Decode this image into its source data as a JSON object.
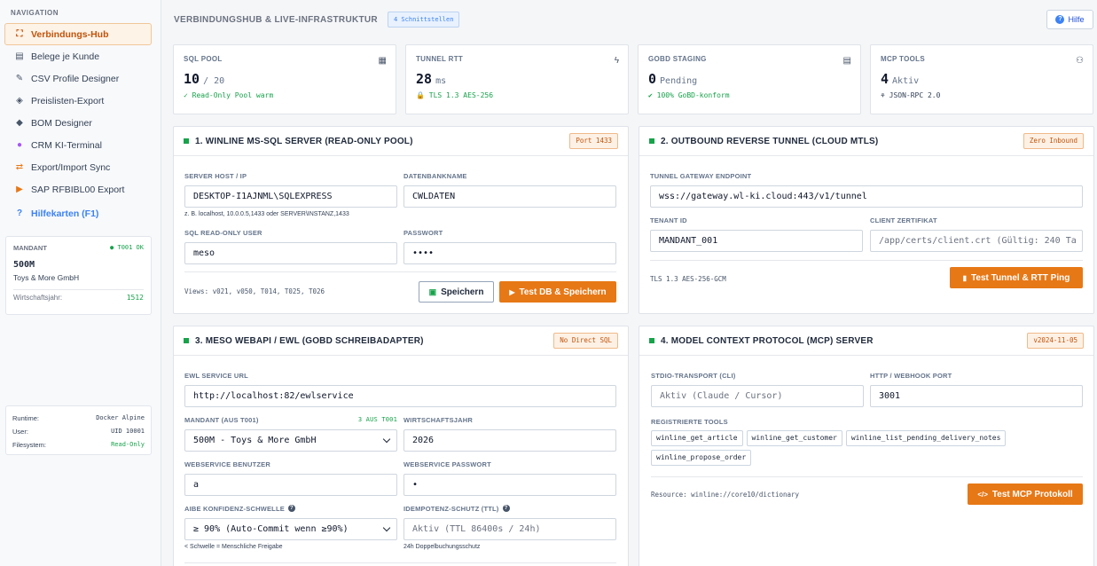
{
  "nav": {
    "heading": "NAVIGATION",
    "items": [
      {
        "label": "Verbindungs-Hub",
        "icon": "network-icon",
        "glyph": "⛶"
      },
      {
        "label": "Belege je Kunde",
        "icon": "document-icon",
        "glyph": "▤"
      },
      {
        "label": "CSV Profile Designer",
        "icon": "wand-icon",
        "glyph": "✎"
      },
      {
        "label": "Preislisten-Export",
        "icon": "tags-icon",
        "glyph": "◈"
      },
      {
        "label": "BOM Designer",
        "icon": "cubes-icon",
        "glyph": "◆"
      },
      {
        "label": "CRM KI-Terminal",
        "icon": "brain-icon",
        "glyph": "●"
      },
      {
        "label": "Export/Import Sync",
        "icon": "exchange-icon",
        "glyph": "⇄"
      },
      {
        "label": "SAP RFBIBL00 Export",
        "icon": "file-export-icon",
        "glyph": "▶"
      }
    ],
    "help": {
      "label": "Hilfekarten (F1)",
      "glyph": "?"
    }
  },
  "mandant": {
    "heading": "MANDANT",
    "status": "T001 OK",
    "code": "500M",
    "name": "Toys & More GmbH",
    "year_label": "Wirtschaftsjahr:",
    "year": "1512"
  },
  "runtime": [
    {
      "k": "Runtime:",
      "v": "Docker Alpine"
    },
    {
      "k": "User:",
      "v": "UID 10001"
    },
    {
      "k": "Filesystem:",
      "v": "Read-Only"
    }
  ],
  "header": {
    "title": "VERBINDUNGSHUB & LIVE-INFRASTRUKTUR",
    "badge": "4 Schnittstellen",
    "help": "Hilfe"
  },
  "stats": [
    {
      "label": "SQL POOL",
      "icon": "database-icon",
      "glyph": "▦",
      "value": "10",
      "unit": "/ 20",
      "sub": "✓ Read-Only Pool warm"
    },
    {
      "label": "TUNNEL RTT",
      "icon": "bolt-icon",
      "glyph": "ϟ",
      "value": "28",
      "unit": "ms",
      "sub": "🔒 TLS 1.3 AES-256"
    },
    {
      "label": "GOBD STAGING",
      "icon": "file-icon",
      "glyph": "▤",
      "value": "0",
      "unit": "Pending",
      "sub": "✔ 100% GoBD-konform"
    },
    {
      "label": "MCP TOOLS",
      "icon": "robot-icon",
      "glyph": "⚇",
      "value": "4",
      "unit": "Aktiv",
      "sub": "⚘ JSON-RPC 2.0"
    }
  ],
  "sql": {
    "title": "1. WINLINE MS-SQL SERVER (READ-ONLY POOL)",
    "tag": "Port 1433",
    "host_label": "SERVER HOST / IP",
    "host": "DESKTOP-I1AJNML\\SQLEXPRESS",
    "host_hint": "z. B. localhost, 10.0.0.5,1433 oder SERVER\\INSTANZ,1433",
    "db_label": "DATENBANKNAME",
    "db": "CWLDATEN",
    "user_label": "SQL READ-ONLY USER",
    "user": "meso",
    "pw_label": "PASSWORT",
    "pw": "••••",
    "views": "Views: v021, v050, T014, T025, T026",
    "save": "Speichern",
    "test": "Test DB & Speichern"
  },
  "tunnel": {
    "title": "2. OUTBOUND REVERSE TUNNEL (CLOUD MTLS)",
    "tag": "Zero Inbound",
    "ep_label": "TUNNEL GATEWAY ENDPOINT",
    "ep": "wss://gateway.wl-ki.cloud:443/v1/tunnel",
    "tid_label": "TENANT ID",
    "tid": "MANDANT_001",
    "cert_label": "CLIENT ZERTIFIKAT",
    "cert": "/app/certs/client.crt (Gültig: 240 Ta",
    "foot": "TLS 1.3 AES-256-GCM",
    "btn": "Test Tunnel & RTT Ping"
  },
  "ewl": {
    "title": "3. MESO WEBAPI / EWL (GOBD SCHREIBADAPTER)",
    "tag": "No Direct SQL",
    "url_label": "EWL SERVICE URL",
    "url": "http://localhost:82/ewlservice",
    "mandant_label": "MANDANT (AUS T001)",
    "mandant_note": "3 AUS T001",
    "mandant": "500M - Toys & More GmbH",
    "wj_label": "WIRTSCHAFTSJAHR",
    "wj": "2026",
    "user_label": "WEBSERVICE BENUTZER",
    "user": "a",
    "pw_label": "WEBSERVICE PASSWORT",
    "pw": "•",
    "conf_label": "AIBE KONFIDENZ-SCHWELLE",
    "conf": "≥ 90% (Auto-Commit wenn ≥90%)",
    "conf_hint": "< Schwelle = Menschliche Freigabe",
    "idem_label": "IDEMPOTENZ-SCHUTZ (TTL)",
    "idem": "Aktiv (TTL 86400s / 24h)",
    "idem_hint": "24h Doppelbuchungsschutz"
  },
  "mcp": {
    "title": "4. MODEL CONTEXT PROTOCOL (MCP) SERVER",
    "tag": "v2024-11-05",
    "stdio_label": "STDIO-TRANSPORT (CLI)",
    "stdio": "Aktiv (Claude / Cursor)",
    "port_label": "HTTP / WEBHOOK PORT",
    "port": "3001",
    "tools_label": "REGISTRIERTE TOOLS",
    "tools": [
      "winline_get_article",
      "winline_get_customer",
      "winline_list_pending_delivery_notes",
      "winline_propose_order"
    ],
    "resource": "Resource: winline://core10/dictionary",
    "btn": "Test MCP Protokoll"
  },
  "colors": {
    "accent": "#e77816",
    "success": "#16a34a",
    "link": "#3b82f6"
  }
}
